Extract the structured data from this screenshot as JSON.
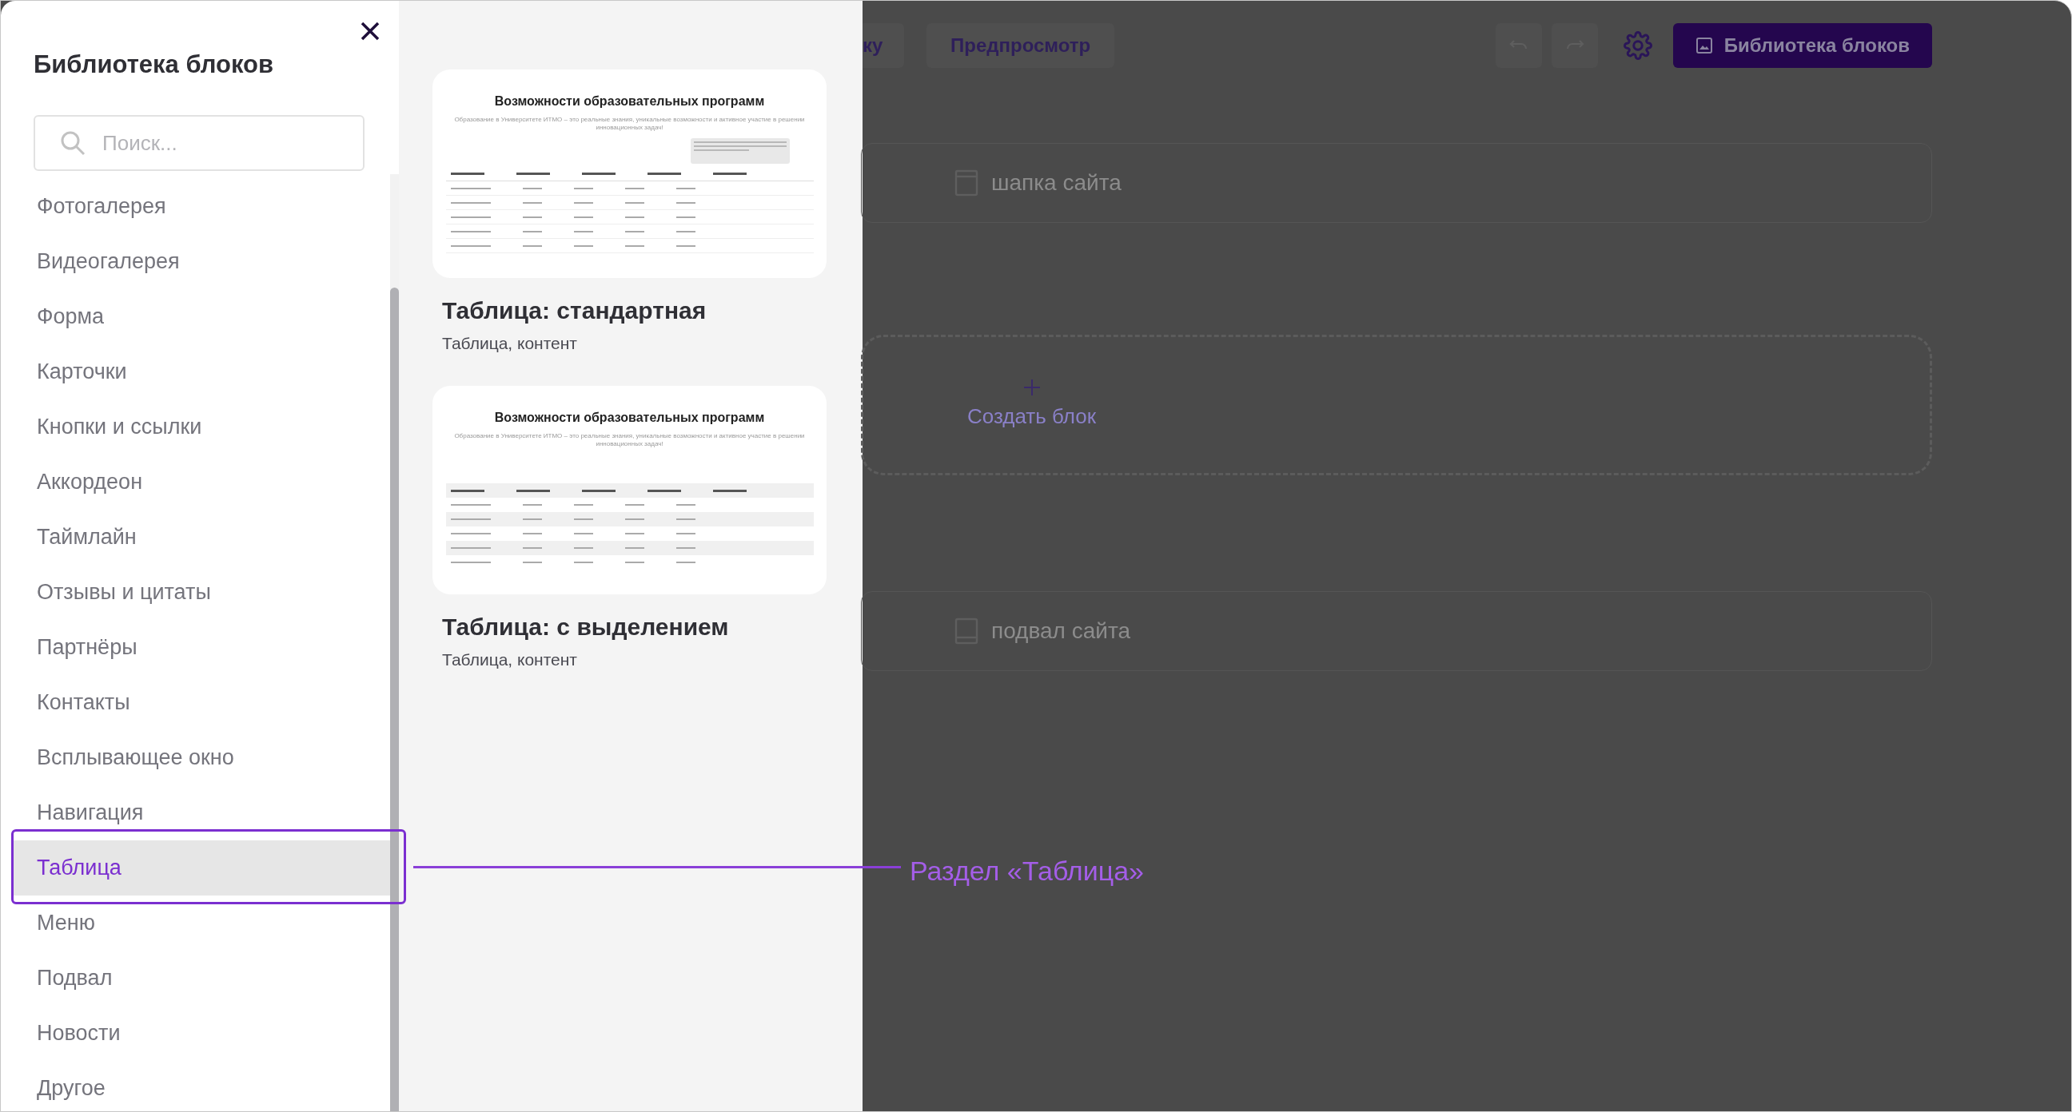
{
  "sidebar": {
    "title": "Библиотека блоков",
    "search": {
      "placeholder": "Поиск..."
    },
    "items": [
      {
        "label": "Фотогалерея",
        "selected": false
      },
      {
        "label": "Видеогалерея",
        "selected": false
      },
      {
        "label": "Форма",
        "selected": false
      },
      {
        "label": "Карточки",
        "selected": false
      },
      {
        "label": "Кнопки и ссылки",
        "selected": false
      },
      {
        "label": "Аккордеон",
        "selected": false
      },
      {
        "label": "Таймлайн",
        "selected": false
      },
      {
        "label": "Отзывы и цитаты",
        "selected": false
      },
      {
        "label": "Партнёры",
        "selected": false
      },
      {
        "label": "Контакты",
        "selected": false
      },
      {
        "label": "Всплывающее окно",
        "selected": false
      },
      {
        "label": "Навигация",
        "selected": false
      },
      {
        "label": "Таблица",
        "selected": true
      },
      {
        "label": "Меню",
        "selected": false
      },
      {
        "label": "Подвал",
        "selected": false
      },
      {
        "label": "Новости",
        "selected": false
      },
      {
        "label": "Другое",
        "selected": false
      }
    ]
  },
  "templates": [
    {
      "preview": {
        "kind": "lines",
        "heading": "Возможности образовательных программ",
        "description": "Образование в Университете ИТМО – это реальные знания, уникальные возможности и активное участие в решении инновационных задач!"
      },
      "title": "Таблица: стандартная",
      "tags": "Таблица, контент"
    },
    {
      "preview": {
        "kind": "striped",
        "heading": "Возможности образовательных программ",
        "description": "Образование в Университете ИТМО – это реальные знания, уникальные возможности и активное участие в решении инновационных задач!"
      },
      "title": "Таблица: с выделением",
      "tags": "Таблица, контент"
    }
  ],
  "editor": {
    "toolbar": {
      "buttons": [
        "ку",
        "Предпросмотр"
      ],
      "library_button": "Библиотека блоков"
    },
    "blocks": [
      {
        "kind": "header",
        "label": "шапка сайта"
      },
      {
        "kind": "create",
        "label": "Создать блок"
      },
      {
        "kind": "footer",
        "label": "подвал сайта"
      }
    ]
  },
  "annotation": {
    "label": "Раздел «Таблица»"
  }
}
